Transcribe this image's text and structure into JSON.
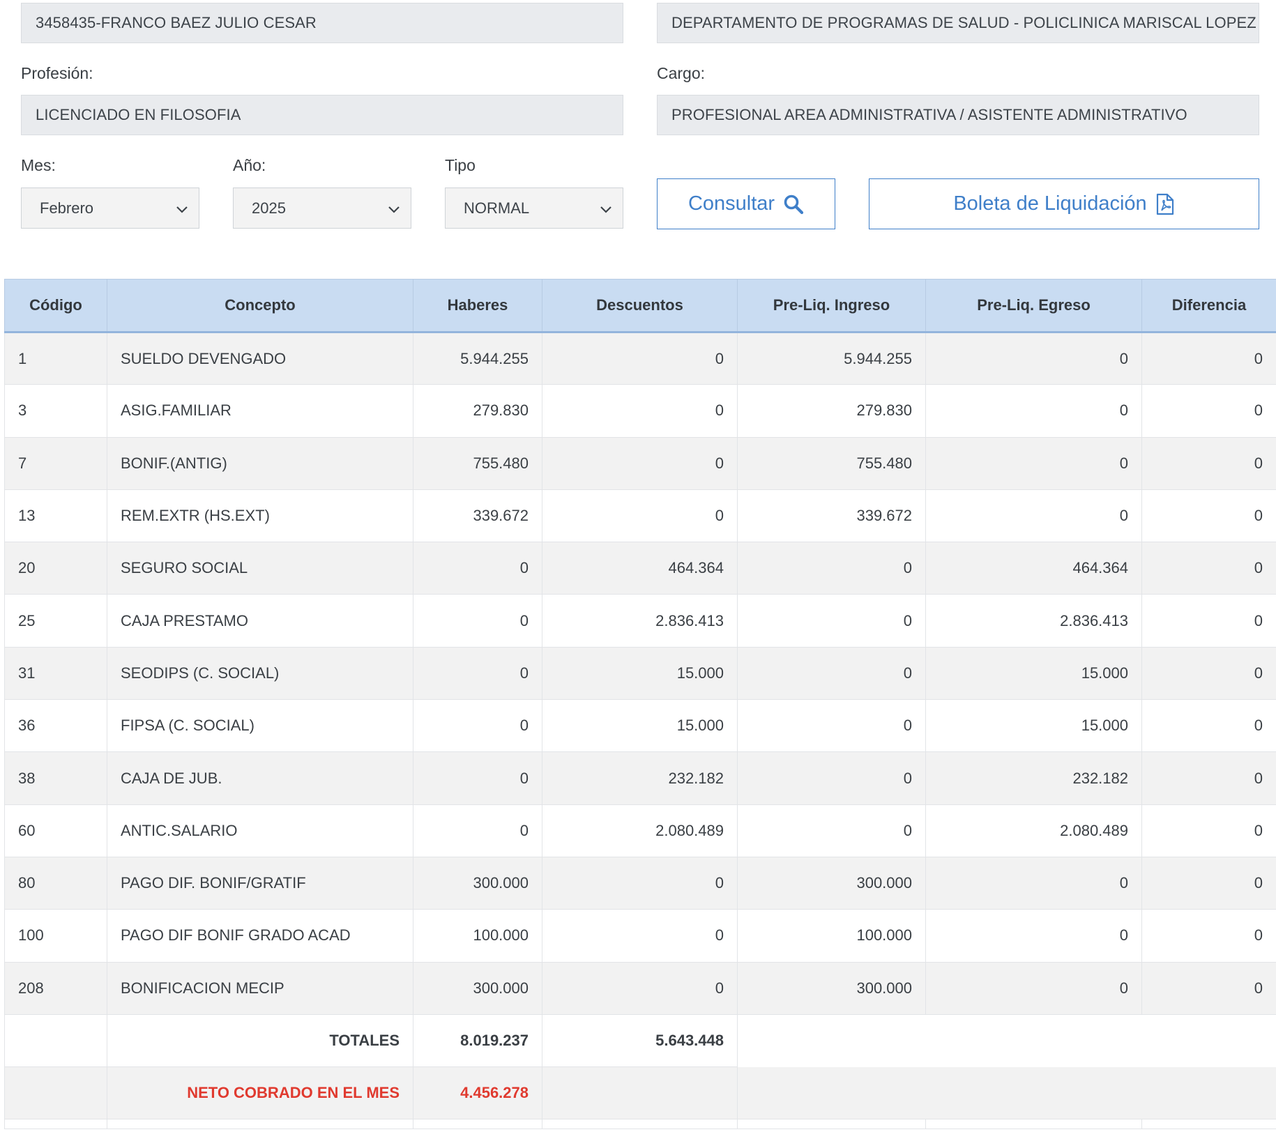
{
  "fields": {
    "funcionario": "3458435-FRANCO BAEZ JULIO CESAR",
    "dependencia": "DEPARTAMENTO DE PROGRAMAS DE SALUD - POLICLINICA MARISCAL LOPEZ",
    "profesion_label": "Profesión:",
    "profesion": "LICENCIADO EN FILOSOFIA",
    "cargo_label": "Cargo:",
    "cargo": "PROFESIONAL AREA ADMINISTRATIVA / ASISTENTE ADMINISTRATIVO"
  },
  "filters": {
    "mes_label": "Mes:",
    "mes": "Febrero",
    "anio_label": "Año:",
    "anio": "2025",
    "tipo_label": "Tipo",
    "tipo": "NORMAL"
  },
  "buttons": {
    "consultar": "Consultar",
    "boleta": "Boleta de Liquidación"
  },
  "table": {
    "headers": [
      "Código",
      "Concepto",
      "Haberes",
      "Descuentos",
      "Pre-Liq. Ingreso",
      "Pre-Liq. Egreso",
      "Diferencia"
    ],
    "rows": [
      [
        "1",
        "SUELDO DEVENGADO",
        "5.944.255",
        "0",
        "5.944.255",
        "0",
        "0"
      ],
      [
        "3",
        "ASIG.FAMILIAR",
        "279.830",
        "0",
        "279.830",
        "0",
        "0"
      ],
      [
        "7",
        "BONIF.(ANTIG)",
        "755.480",
        "0",
        "755.480",
        "0",
        "0"
      ],
      [
        "13",
        "REM.EXTR (HS.EXT)",
        "339.672",
        "0",
        "339.672",
        "0",
        "0"
      ],
      [
        "20",
        "SEGURO SOCIAL",
        "0",
        "464.364",
        "0",
        "464.364",
        "0"
      ],
      [
        "25",
        "CAJA PRESTAMO",
        "0",
        "2.836.413",
        "0",
        "2.836.413",
        "0"
      ],
      [
        "31",
        "SEODIPS (C. SOCIAL)",
        "0",
        "15.000",
        "0",
        "15.000",
        "0"
      ],
      [
        "36",
        "FIPSA (C. SOCIAL)",
        "0",
        "15.000",
        "0",
        "15.000",
        "0"
      ],
      [
        "38",
        "CAJA DE JUB.",
        "0",
        "232.182",
        "0",
        "232.182",
        "0"
      ],
      [
        "60",
        "ANTIC.SALARIO",
        "0",
        "2.080.489",
        "0",
        "2.080.489",
        "0"
      ],
      [
        "80",
        "PAGO DIF. BONIF/GRATIF",
        "300.000",
        "0",
        "300.000",
        "0",
        "0"
      ],
      [
        "100",
        "PAGO DIF BONIF GRADO ACAD",
        "100.000",
        "0",
        "100.000",
        "0",
        "0"
      ],
      [
        "208",
        "BONIFICACION MECIP",
        "300.000",
        "0",
        "300.000",
        "0",
        "0"
      ]
    ],
    "totales_label": "TOTALES",
    "totales_haberes": "8.019.237",
    "totales_descuentos": "5.643.448",
    "neto_label": "NETO COBRADO EN EL MES",
    "neto_valor": "4.456.278"
  },
  "colors": {
    "accent": "#3f7fc9",
    "header_bg": "#c9dcf2",
    "neto_red": "#e03a2f"
  }
}
